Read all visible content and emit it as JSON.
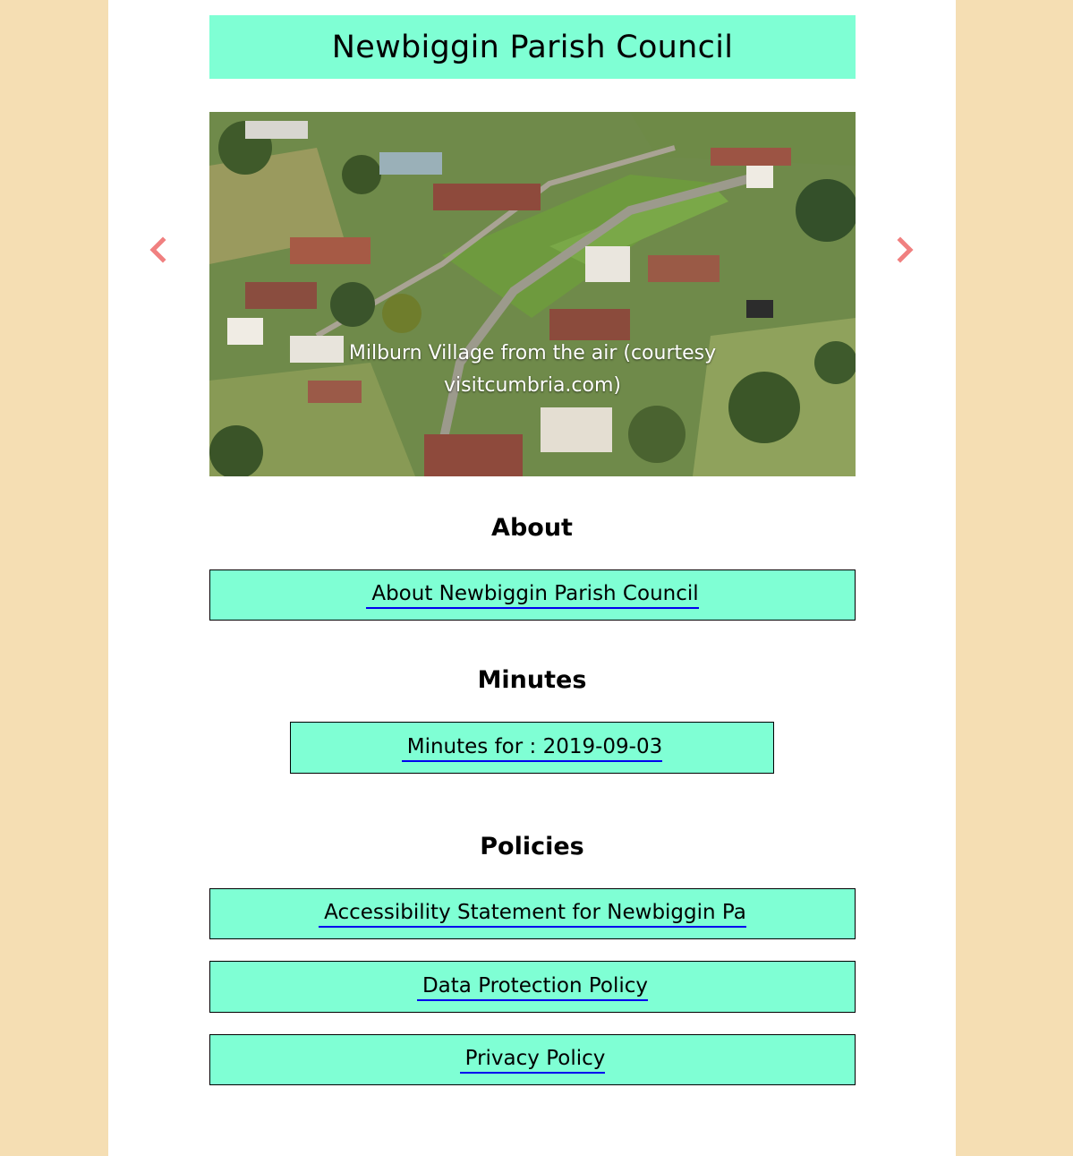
{
  "header": {
    "title": "Newbiggin Parish Council"
  },
  "carousel": {
    "caption": "Milburn Village from the air (courtesy visitcumbria.com)",
    "prev_icon": "chevron-left-icon",
    "next_icon": "chevron-right-icon",
    "arrow_color": "#f08080"
  },
  "about": {
    "heading": "About",
    "link": "About Newbiggin Parish Council"
  },
  "minutes": {
    "heading": "Minutes",
    "link": "Minutes for : 2019-09-03"
  },
  "policies": {
    "heading": "Policies",
    "items": [
      {
        "label": "Accessibility Statement for Newbiggin Pa"
      },
      {
        "label": "Data Protection Policy"
      },
      {
        "label": "Privacy Policy"
      }
    ]
  },
  "colors": {
    "outer_background": "#f5deb3",
    "page_background": "#ffffff",
    "box_background": "#7fffd4",
    "link_underline": "#0000ee"
  }
}
